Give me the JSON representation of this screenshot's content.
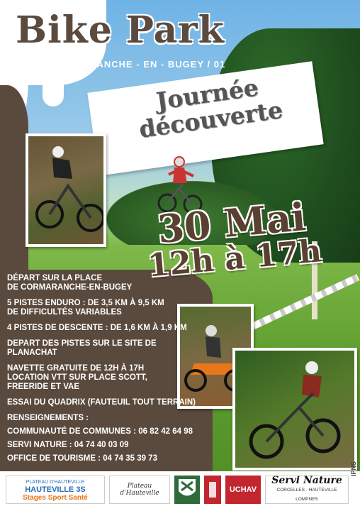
{
  "title": "Bike Park",
  "subtitle": "CORMARANCHE - EN - BUGEY / 01",
  "banner": {
    "line1": "Journée",
    "line2": "découverte"
  },
  "date": {
    "day": "30 Mai",
    "hours": "12h à 17h"
  },
  "info": {
    "depart_l1": "DÉPART SUR LA PLACE",
    "depart_l2": "DE CORMARANCHE-EN-BUGEY",
    "enduro_l1": "5 PISTES ENDURO : DE 3,5 KM À 9,5 KM",
    "enduro_l2": "DE DIFFICULTÉS VARIABLES",
    "descente": "4 PISTES DE DESCENTE : DE 1,6 KM À 1,9 KM",
    "planachat": "DEPART DES PISTES SUR LE SITE DE PLANACHAT",
    "navette_l1": "NAVETTE GRATUITE DE 12H À 17H",
    "navette_l2": "LOCATION VTT SUR PLACE SCOTT,",
    "navette_l3": "FREERIDE ET VAE",
    "quadrix": "ESSAI DU QUADRIX (FAUTEUIL TOUT TERRAIN)",
    "renseignements": "RENSEIGNEMENTS :",
    "contact1": "COMMUNAUTÉ DE COMMUNES : 06 82 42 64 98",
    "contact2": "SERVI NATURE : 04 74 40 03 09",
    "contact3": "OFFICE DE TOURISME : 04 74 35 39 73"
  },
  "footer": {
    "logo1_l1": "PLATEAU D'HAUTEVILLE",
    "logo1_l2": "HAUTEVILLE 3S",
    "logo1_l3": "Stages Sport Santé",
    "logo2": "Plateau d'Hauteville",
    "logo5": "UCHAV",
    "logo6_l1": "Servi Nature",
    "logo6_l2": "CORCELLES - HAUTEVILLE LOMPNES",
    "ipns": "IPNS"
  }
}
